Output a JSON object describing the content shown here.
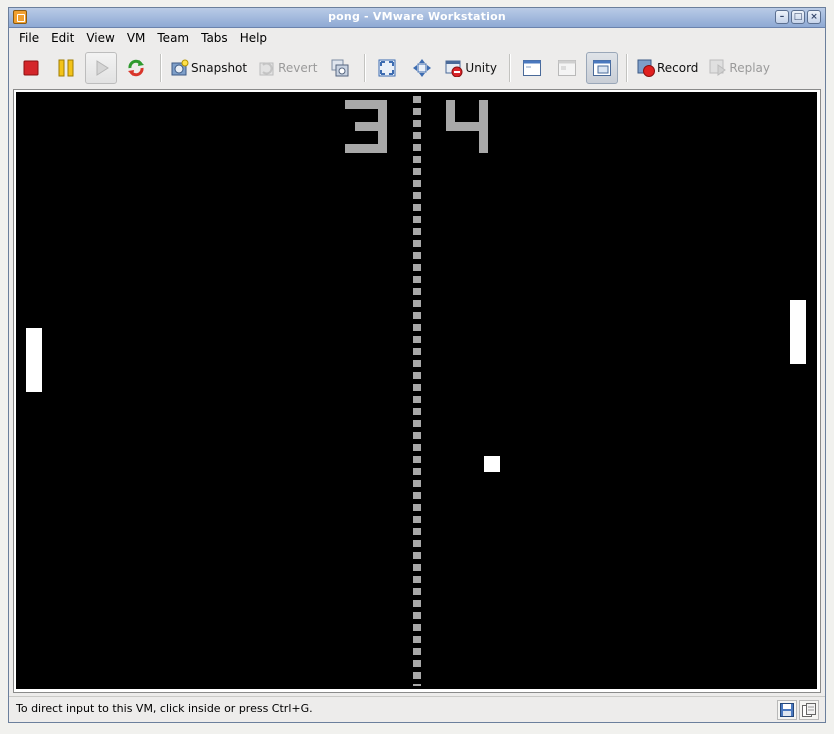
{
  "window": {
    "title": "pong - VMware Workstation",
    "controls": [
      "minimize-icon",
      "maximize-icon",
      "close-icon"
    ]
  },
  "menu": [
    {
      "label": "File"
    },
    {
      "label": "Edit"
    },
    {
      "label": "View"
    },
    {
      "label": "VM"
    },
    {
      "label": "Team"
    },
    {
      "label": "Tabs"
    },
    {
      "label": "Help"
    }
  ],
  "toolbar": {
    "snapshot_label": "Snapshot",
    "revert_label": "Revert",
    "unity_label": "Unity",
    "record_label": "Record",
    "replay_label": "Replay"
  },
  "game": {
    "score_left": "3",
    "score_right": "4",
    "colors": {
      "background": "#000000",
      "net": "#a8a8a8",
      "score": "#a8a8a8",
      "paddle": "#ffffff",
      "ball": "#ffffff"
    }
  },
  "status": {
    "message": "To direct input to this VM, click inside or press Ctrl+G."
  }
}
